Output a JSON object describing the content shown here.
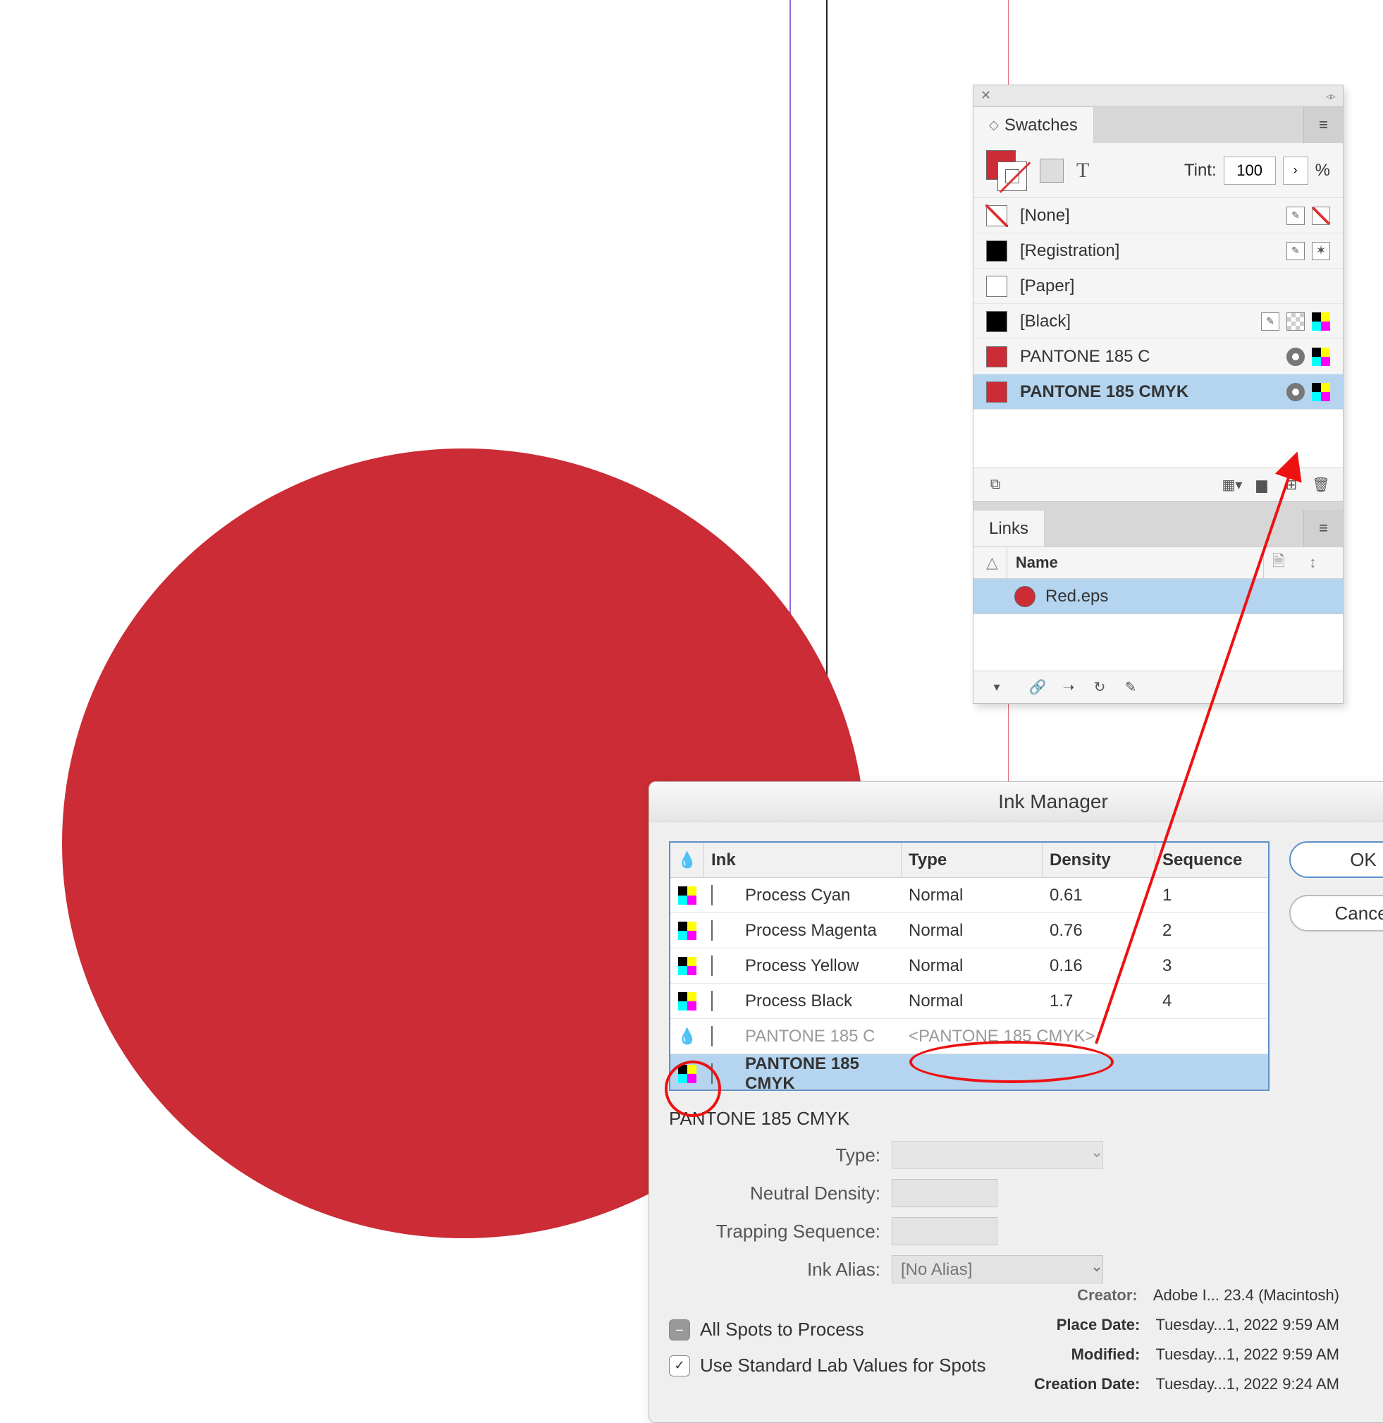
{
  "swatches_panel": {
    "title": "Swatches",
    "tint_label": "Tint:",
    "tint_value": "100",
    "tint_unit": "%",
    "items": [
      {
        "name": "[None]",
        "chip": "none",
        "icons": [
          "noedit",
          "nonprint"
        ]
      },
      {
        "name": "[Registration]",
        "chip": "black",
        "icons": [
          "noedit",
          "registration"
        ]
      },
      {
        "name": "[Paper]",
        "chip": "white",
        "icons": []
      },
      {
        "name": "[Black]",
        "chip": "black",
        "icons": [
          "noedit",
          "checker",
          "cmyk"
        ]
      },
      {
        "name": "PANTONE 185 C",
        "chip": "red",
        "icons": [
          "spot",
          "cmyk"
        ]
      },
      {
        "name": "PANTONE 185 CMYK",
        "chip": "red",
        "icons": [
          "spot",
          "cmyk"
        ],
        "selected": true,
        "bold": true
      }
    ]
  },
  "links_panel": {
    "title": "Links",
    "header_name": "Name",
    "items": [
      {
        "name": "Red.eps"
      }
    ]
  },
  "ink_manager": {
    "title": "Ink Manager",
    "columns": {
      "ink": "Ink",
      "type": "Type",
      "density": "Density",
      "sequence": "Sequence"
    },
    "rows": [
      {
        "chip": "cyan",
        "name": "Process Cyan",
        "type": "Normal",
        "density": "0.61",
        "seq": "1"
      },
      {
        "chip": "mag",
        "name": "Process Magenta",
        "type": "Normal",
        "density": "0.76",
        "seq": "2"
      },
      {
        "chip": "yel",
        "name": "Process Yellow",
        "type": "Normal",
        "density": "0.16",
        "seq": "3"
      },
      {
        "chip": "blk",
        "name": "Process Black",
        "type": "Normal",
        "density": "1.7",
        "seq": "4"
      },
      {
        "chip": "grey",
        "name": "PANTONE 185 C",
        "type": "<PANTONE 185 CMYK>",
        "density": "",
        "seq": "",
        "aliased": true
      },
      {
        "chip": "red2",
        "name": "PANTONE 185 CMYK",
        "type": "",
        "density": "",
        "seq": "",
        "selected": true
      }
    ],
    "detail_heading": "PANTONE 185 CMYK",
    "labels": {
      "type": "Type:",
      "density": "Neutral Density:",
      "seq": "Trapping Sequence:",
      "alias": "Ink Alias:"
    },
    "alias_value": "[No Alias]",
    "check_all_spots": "All Spots to Process",
    "check_lab": "Use Standard Lab Values for Spots",
    "btn_ok": "OK",
    "btn_cancel": "Cancel"
  },
  "metadata": {
    "creator_label": "Creator:",
    "creator_value": "Adobe I... 23.4 (Macintosh)",
    "place_label": "Place Date:",
    "place_value": "Tuesday...1, 2022 9:59 AM",
    "mod_label": "Modified:",
    "mod_value": "Tuesday...1, 2022 9:59 AM",
    "created_label": "Creation Date:",
    "created_value": "Tuesday...1, 2022 9:24 AM"
  }
}
